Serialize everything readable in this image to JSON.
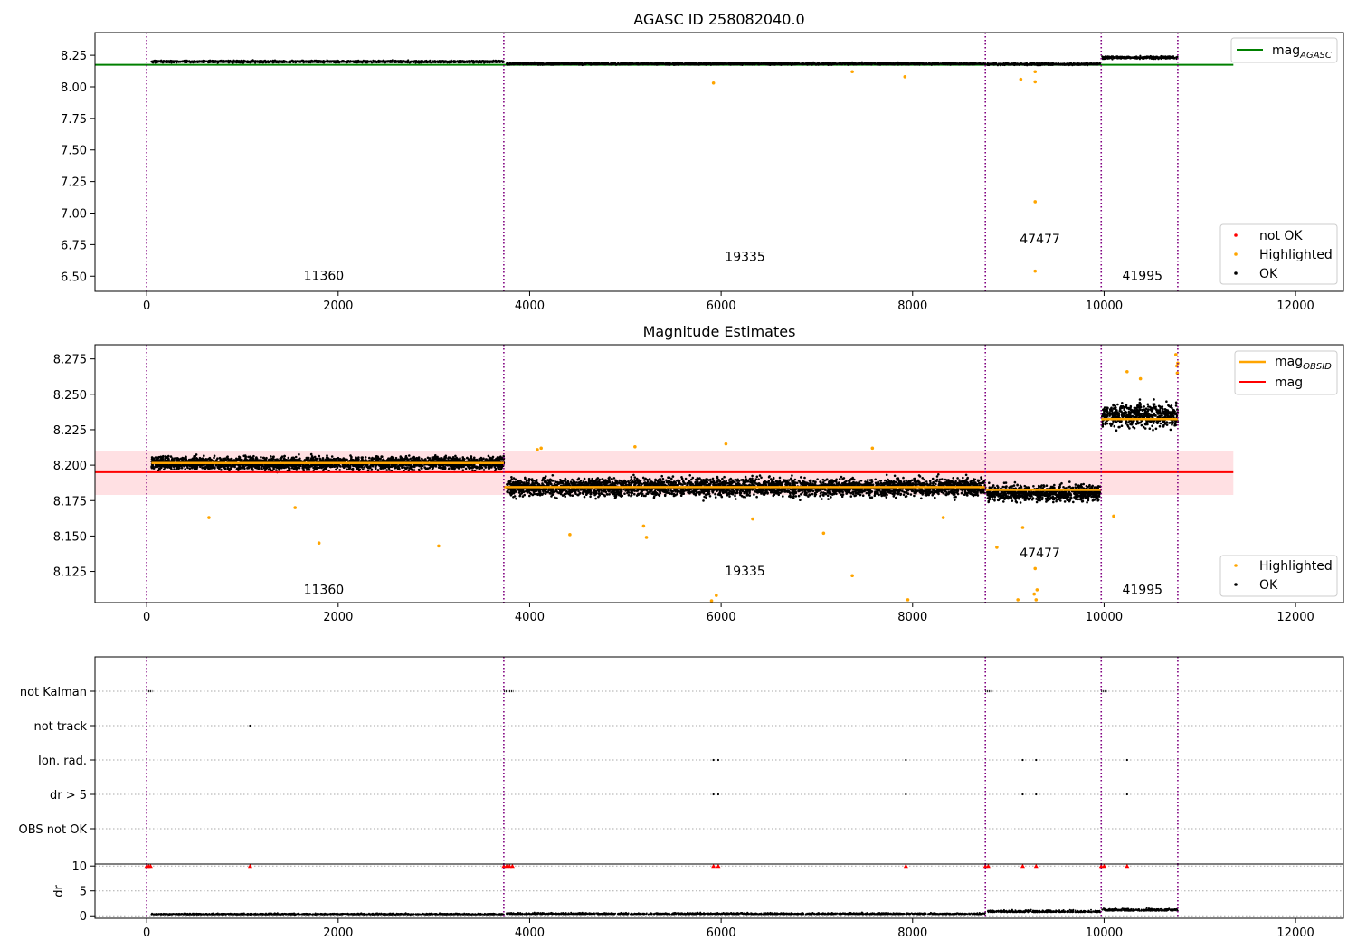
{
  "figure": {
    "top_title": "AGASC ID 258082040.0",
    "mid_title": "Magnitude Estimates"
  },
  "chart_data": [
    {
      "type": "scatter",
      "title": "AGASC ID 258082040.0",
      "xlim": [
        -540,
        12500
      ],
      "ylim": [
        6.38,
        8.43
      ],
      "xticks": [
        0,
        2000,
        4000,
        6000,
        8000,
        10000,
        12000
      ],
      "xtick_labels": [
        "0",
        "2000",
        "4000",
        "6000",
        "8000",
        "10000",
        "12000"
      ],
      "yticks": [
        6.5,
        6.75,
        7.0,
        7.25,
        7.5,
        7.75,
        8.0,
        8.25
      ],
      "ytick_labels": [
        "6.50",
        "6.75",
        "7.00",
        "7.25",
        "7.50",
        "7.75",
        "8.00",
        "8.25"
      ],
      "obs_boundaries": [
        0,
        3730,
        8760,
        9970,
        10770
      ],
      "obs_labels": [
        {
          "text": "11360",
          "x": 1850,
          "y": 6.47
        },
        {
          "text": "19335",
          "x": 6250,
          "y": 6.62
        },
        {
          "text": "47477",
          "x": 9330,
          "y": 6.76
        },
        {
          "text": "41995",
          "x": 10400,
          "y": 6.47
        }
      ],
      "lines": [
        {
          "name": "mag_AGASC",
          "value": 8.175,
          "x_range": [
            -540,
            11350
          ],
          "color": "#008000"
        }
      ],
      "segments": [
        {
          "x_range": [
            50,
            3730
          ],
          "level": 8.2,
          "spread": 0.008
        },
        {
          "x_range": [
            3760,
            8760
          ],
          "level": 8.183,
          "spread": 0.008
        },
        {
          "x_range": [
            8780,
            9960
          ],
          "level": 8.18,
          "spread": 0.008
        },
        {
          "x_range": [
            9980,
            10770
          ],
          "level": 8.232,
          "spread": 0.01
        }
      ],
      "highlighted_points": [
        [
          5920,
          8.03
        ],
        [
          9280,
          7.09
        ],
        [
          9280,
          6.54
        ],
        [
          9280,
          8.04
        ],
        [
          9280,
          8.12
        ],
        [
          7920,
          8.08
        ],
        [
          9130,
          8.06
        ],
        [
          7370,
          8.12
        ]
      ],
      "legend_top": [
        "mag_AGASC"
      ],
      "legend_bottom": [
        {
          "name": "not OK",
          "color": "#ff0000"
        },
        {
          "name": "Highlighted",
          "color": "#ffa500"
        },
        {
          "name": "OK",
          "color": "#000000"
        }
      ]
    },
    {
      "type": "scatter",
      "title": "Magnitude Estimates",
      "xlim": [
        -540,
        12500
      ],
      "ylim": [
        8.103,
        8.285
      ],
      "xticks": [
        0,
        2000,
        4000,
        6000,
        8000,
        10000,
        12000
      ],
      "xtick_labels": [
        "0",
        "2000",
        "4000",
        "6000",
        "8000",
        "10000",
        "12000"
      ],
      "yticks": [
        8.125,
        8.15,
        8.175,
        8.2,
        8.225,
        8.25,
        8.275
      ],
      "ytick_labels": [
        "8.125",
        "8.150",
        "8.175",
        "8.200",
        "8.225",
        "8.250",
        "8.275"
      ],
      "obs_boundaries": [
        0,
        3730,
        8760,
        9970,
        10770
      ],
      "obs_labels": [
        {
          "text": "11360",
          "x": 1850,
          "y": 8.109
        },
        {
          "text": "19335",
          "x": 6250,
          "y": 8.122
        },
        {
          "text": "47477",
          "x": 9330,
          "y": 8.135
        },
        {
          "text": "41995",
          "x": 10400,
          "y": 8.109
        }
      ],
      "mag": {
        "value": 8.195,
        "band": [
          8.179,
          8.21
        ],
        "x_range": [
          -540,
          11350
        ],
        "color": "#ff0000",
        "band_color": "#ffe0e3"
      },
      "mag_obsid": [
        {
          "x_range": [
            50,
            3730
          ],
          "value": 8.2015
        },
        {
          "x_range": [
            3730,
            8760
          ],
          "value": 8.1845
        },
        {
          "x_range": [
            8760,
            9970
          ],
          "value": 8.1825
        },
        {
          "x_range": [
            9970,
            10770
          ],
          "value": 8.2325
        }
      ],
      "segments": [
        {
          "x_range": [
            50,
            3730
          ],
          "level": 8.2015,
          "spread": 0.0045
        },
        {
          "x_range": [
            3760,
            8760
          ],
          "level": 8.1845,
          "spread": 0.006
        },
        {
          "x_range": [
            8780,
            9960
          ],
          "level": 8.1805,
          "spread": 0.0055
        },
        {
          "x_range": [
            9980,
            10770
          ],
          "level": 8.235,
          "spread": 0.008
        }
      ],
      "highlighted_points": [
        [
          650,
          8.163
        ],
        [
          1800,
          8.145
        ],
        [
          3050,
          8.143
        ],
        [
          1550,
          8.17
        ],
        [
          4420,
          8.151
        ],
        [
          5220,
          8.149
        ],
        [
          5190,
          8.157
        ],
        [
          5900,
          8.104
        ],
        [
          5950,
          8.108
        ],
        [
          6330,
          8.162
        ],
        [
          7070,
          8.152
        ],
        [
          7370,
          8.122
        ],
        [
          8320,
          8.163
        ],
        [
          8880,
          8.142
        ],
        [
          9150,
          8.156
        ],
        [
          9280,
          8.127
        ],
        [
          9300,
          8.112
        ],
        [
          9270,
          8.109
        ],
        [
          9100,
          8.105
        ],
        [
          9290,
          8.105
        ],
        [
          7950,
          8.105
        ],
        [
          10100,
          8.164
        ],
        [
          4080,
          8.211
        ],
        [
          4120,
          8.212
        ],
        [
          5100,
          8.213
        ],
        [
          6050,
          8.215
        ],
        [
          7580,
          8.212
        ],
        [
          10240,
          8.266
        ],
        [
          10380,
          8.261
        ],
        [
          10750,
          8.278
        ],
        [
          10760,
          8.27
        ],
        [
          10770,
          8.272
        ],
        [
          10765,
          8.265
        ]
      ],
      "legend_top": [
        "mag_OBSID",
        "mag"
      ],
      "legend_bottom": [
        {
          "name": "Highlighted",
          "color": "#ffa500"
        },
        {
          "name": "OK",
          "color": "#000000"
        }
      ]
    },
    {
      "type": "scatter",
      "title": "",
      "xlim": [
        -540,
        12500
      ],
      "categories": [
        "not Kalman",
        "not track",
        "Ion. rad.",
        "dr > 5",
        "OBS not OK"
      ],
      "flag_points": {
        "not Kalman": [
          [
            0,
            60
          ],
          [
            3730,
            100
          ],
          [
            8760,
            60
          ],
          [
            9970,
            60
          ]
        ],
        "not track": [
          [
            1080,
            0
          ]
        ],
        "Ion. rad.": [
          [
            5920,
            0
          ],
          [
            5970,
            0
          ],
          [
            7930,
            0
          ],
          [
            9150,
            0
          ],
          [
            9290,
            0
          ],
          [
            10240,
            0
          ]
        ],
        "dr > 5": [
          [
            5920,
            0
          ],
          [
            5970,
            0
          ],
          [
            7930,
            0
          ],
          [
            9150,
            0
          ],
          [
            9290,
            0
          ],
          [
            10240,
            0
          ]
        ],
        "OBS not OK": []
      },
      "obs_boundaries": [
        0,
        3730,
        8760,
        9970,
        10770
      ]
    },
    {
      "type": "scatter",
      "title": "",
      "ylabel": "dr",
      "xlim": [
        -540,
        12500
      ],
      "ylim": [
        -0.5,
        10.4
      ],
      "xticks": [
        0,
        2000,
        4000,
        6000,
        8000,
        10000,
        12000
      ],
      "xtick_labels": [
        "0",
        "2000",
        "4000",
        "6000",
        "8000",
        "10000",
        "12000"
      ],
      "yticks": [
        0,
        5,
        10
      ],
      "ytick_labels": [
        "0",
        "5",
        "10"
      ],
      "red_markers_x": [
        0,
        20,
        40,
        1080,
        3730,
        3760,
        3790,
        3820,
        5920,
        5970,
        7930,
        8760,
        8790,
        9150,
        9290,
        9970,
        10000,
        10240
      ],
      "segments": [
        {
          "x_range": [
            50,
            3730
          ],
          "level": 0.25,
          "spread": 0.2
        },
        {
          "x_range": [
            3760,
            8760
          ],
          "level": 0.3,
          "spread": 0.25
        },
        {
          "x_range": [
            8780,
            9960
          ],
          "level": 0.7,
          "spread": 0.4
        },
        {
          "x_range": [
            9980,
            10770
          ],
          "level": 1.0,
          "spread": 0.4
        }
      ],
      "obs_boundaries": [
        0,
        3730,
        8760,
        9970,
        10770
      ]
    }
  ]
}
